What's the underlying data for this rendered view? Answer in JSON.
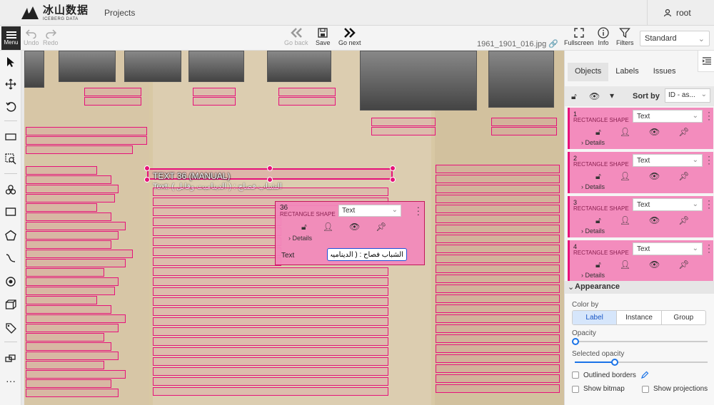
{
  "header": {
    "logo_cn": "冰山数据",
    "logo_en": "ICEBERG DATA",
    "projects": "Projects",
    "user": "root"
  },
  "toolbar": {
    "menu": "Menu",
    "undo": "Undo",
    "redo": "Redo",
    "go_back": "Go back",
    "save": "Save",
    "go_next": "Go next",
    "filename": "1961_1901_016.jpg",
    "fullscreen": "Fullscreen",
    "info": "Info",
    "filters": "Filters",
    "workspace": "Standard"
  },
  "canvas": {
    "selected_label": "TEXT 36 (MANUAL)",
    "selected_text": "Text: الشباب فصاح : ( الديناميت وقابل )",
    "popup": {
      "number": "36",
      "type": "RECTANGLE SHAPE",
      "label": "Text",
      "details": "Details",
      "text_label": "Text",
      "text_value": "الشباب فصاح : ( الديناميت وقابل )"
    }
  },
  "panel": {
    "tabs": [
      "Objects",
      "Labels",
      "Issues"
    ],
    "sort_by": "Sort by",
    "sort_value": "ID - as...",
    "objects": [
      {
        "number": "1",
        "type": "RECTANGLE SHAPE",
        "label": "Text",
        "details": "Details"
      },
      {
        "number": "2",
        "type": "RECTANGLE SHAPE",
        "label": "Text",
        "details": "Details"
      },
      {
        "number": "3",
        "type": "RECTANGLE SHAPE",
        "label": "Text",
        "details": "Details"
      },
      {
        "number": "4",
        "type": "RECTANGLE SHAPE",
        "label": "Text",
        "details": "Details"
      }
    ],
    "appearance": {
      "title": "Appearance",
      "color_by": "Color by",
      "color_options": [
        "Label",
        "Instance",
        "Group"
      ],
      "active_color_option": "Label",
      "opacity": "Opacity",
      "opacity_value": 0,
      "selected_opacity": "Selected opacity",
      "selected_opacity_value": 0.3,
      "outlined_borders": "Outlined borders",
      "show_bitmap": "Show bitmap",
      "show_projections": "Show projections"
    }
  },
  "colors": {
    "accent": "#e6127a",
    "card": "#f38cbd",
    "primary": "#1a73e8"
  }
}
